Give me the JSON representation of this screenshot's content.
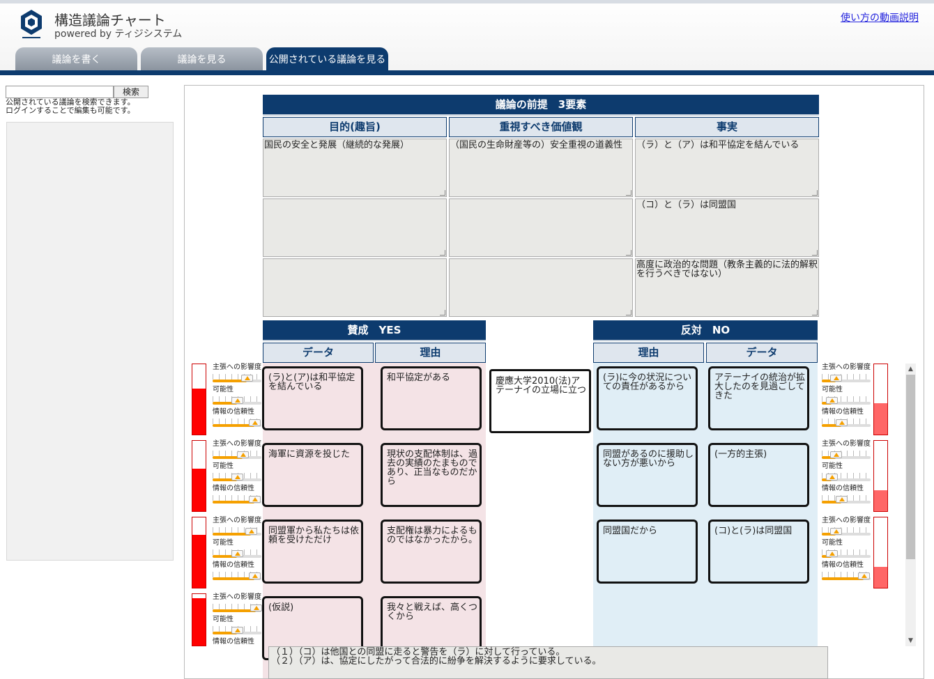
{
  "app": {
    "title": "構造議論チャート",
    "subtitle": "powered by ティジシステム",
    "help_link": "使い方の動画説明"
  },
  "tabs": [
    {
      "label": "議論を書く",
      "active": false
    },
    {
      "label": "議論を見る",
      "active": false
    },
    {
      "label": "公開されている議論を見る",
      "active": true
    }
  ],
  "sidebar": {
    "search_value": "",
    "search_button": "検索",
    "desc_line1": "公開されている議論を検索できます。",
    "desc_line2": "ログインすることで編集も可能です。"
  },
  "premise": {
    "title": "議論の前提　3要素",
    "columns": [
      "目的(趣旨)",
      "重視すべき価値観",
      "事実"
    ],
    "rows": [
      [
        "国民の安全と発展（継続的な発展）",
        "（国民の生命財産等の）安全重視の道義性",
        "（ラ）と（ア）は和平協定を結んでいる"
      ],
      [
        "",
        "",
        "（コ）と（ラ）は同盟国"
      ],
      [
        "",
        "",
        "高度に政治的な問題（教条主義的に法的解釈を行うべきではない）"
      ]
    ]
  },
  "pro": {
    "title": "賛成　YES",
    "col_data": "データ",
    "col_reason": "理由",
    "rows": [
      {
        "data": "(ラ)と(ア)は和平協定を結んでいる",
        "reason": "和平協定がある"
      },
      {
        "data": "海軍に資源を投じた",
        "reason": "現状の支配体制は、過去の実績のたまものであり、正当なものだから"
      },
      {
        "data": "同盟軍から私たちは依頼を受けただけ",
        "reason": "支配権は暴力によるものではなかったから。"
      },
      {
        "data": "(仮説)",
        "reason": "我々と戦えば、高くつくから"
      }
    ]
  },
  "con": {
    "title": "反対　NO",
    "col_reason": "理由",
    "col_data": "データ",
    "rows": [
      {
        "reason": "(ラ)に今の状況についての責任があるから",
        "data": "アテーナイの統治が拡大したのを見過ごしてきた"
      },
      {
        "reason": "同盟があるのに援助しない方が悪いから",
        "data": "(一方的主張)"
      },
      {
        "reason": "同盟国だから",
        "data": "(コ)と(ラ)は同盟国"
      }
    ]
  },
  "claim": "慶應大学2010(法)アテーナイの立場に立つ",
  "slider_labels": {
    "impact": "主張への影響度",
    "possibility": "可能性",
    "reliability": "情報の信頼性"
  },
  "left_scores": [
    {
      "impact": 0.7,
      "possibility": 0.5,
      "reliability": 0.85,
      "meter": 0.65
    },
    {
      "impact": 0.62,
      "possibility": 0.5,
      "reliability": 0.85,
      "meter": 0.6
    },
    {
      "impact": 0.78,
      "possibility": 0.5,
      "reliability": 0.85,
      "meter": 0.75
    },
    {
      "impact": 0.88,
      "possibility": 0.5,
      "reliability": 0.85,
      "meter": 0.92
    }
  ],
  "right_scores": [
    {
      "impact": 0.28,
      "possibility": 0.2,
      "reliability": 0.4,
      "meter": 0.45
    },
    {
      "impact": 0.28,
      "possibility": 0.2,
      "reliability": 0.4,
      "meter": 0.3
    },
    {
      "impact": 0.28,
      "possibility": 0.2,
      "reliability": 0.85,
      "meter": 0.3
    }
  ],
  "colors": {
    "navy": "#0d3b6e",
    "pro_bg": "#f4e3e6",
    "con_bg": "#e0eef6",
    "meter_red": "#ff0000",
    "meter_soft_red": "#ff6666",
    "slider_orange": "#f5a000"
  },
  "notes": [
    "（１）（コ）は他国との同盟に走ると警告を（ラ）に対して行っている。",
    "（２）（ア）は、協定にしたがって合法的に紛争を解決するように要求している。"
  ]
}
